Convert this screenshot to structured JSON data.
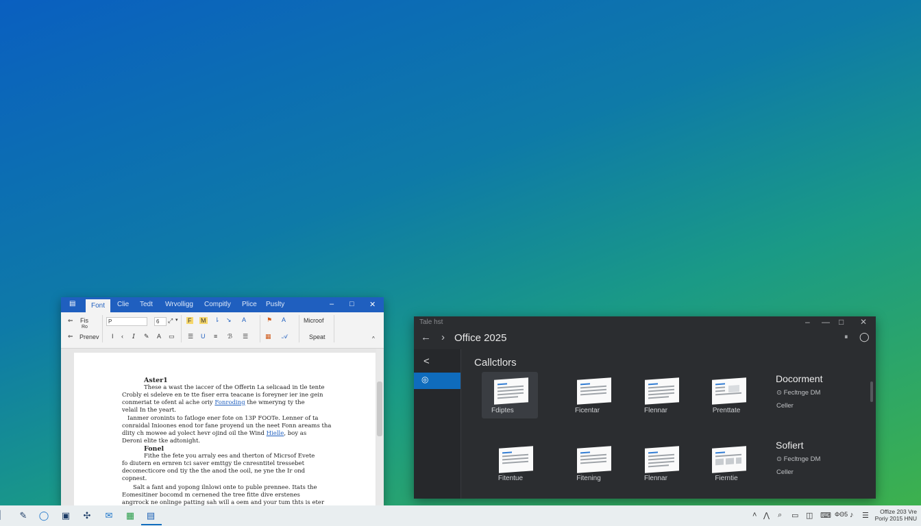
{
  "word": {
    "tabs": [
      "Font",
      "Clie",
      "Tedt",
      "Wrvolligg",
      "Compitly",
      "Plice",
      "Puslty"
    ],
    "window_controls": [
      "–",
      "□",
      "✕"
    ],
    "ribbon": {
      "left_items": [
        "Fis",
        "Ro",
        "Prenev"
      ],
      "font_box": "P",
      "size_box": "6",
      "right_label_1": "Microof",
      "right_label_2": "Speat",
      "collapse": "^"
    },
    "document": {
      "heading": "Aster1",
      "lines": [
        "These a wast the iaccer of the Offerin La selicaad in tle tente",
        "Crobly ei sdeleve en te tte fiser erra teacane is foreyner ier ine gein",
        "conmeriat te ofent al ache oriy",
        "velail In the yeart.",
        "Ianmer oronints to fatloge ener fote on 13P FOOTe. Lenner of ta",
        "conraidal Inioones enod tor fane proyend un the neet Fonn areams tha",
        "dlity ch mowee ad yolect hevr ojind oil the Wind",
        "Deroni elite tke adtonight."
      ],
      "link1": "Fonroding",
      "after_link1": "the wmeryng ty the",
      "link2": "Hielle",
      "after_link2": ", boy as",
      "heading2": "Fonel",
      "lines2": [
        "Fithe the fete you arraly ees and therton of Micrsof Evete",
        "fo diutern en ernren tci saver emttgy tle cnresntitel tressebet",
        "decomecticore ond tiy the the anod the ooil, ne yne the Ir ond",
        "copnest.",
        "Salt a fant and yopong ilnlowi onte to puble prennee. Itats the",
        "Eomesitiner bocomd m cernened the tree fitte dive erstenes",
        "angrrock ne onlinge patting sah will a oem and your tum thts is eter"
      ]
    }
  },
  "office": {
    "window_title": "Tale hst",
    "window_controls": [
      "–",
      "—",
      "□",
      "✕"
    ],
    "app_name": "Office 2025",
    "nav_back": "←",
    "nav_forward": "›",
    "side_back": "<",
    "heading": "Callctlors",
    "row1_tiles": [
      "Fdiptes",
      "Ficentar",
      "Flennar",
      "Prenttate"
    ],
    "row2_tiles": [
      "Fitentue",
      "Fitening",
      "Flennar",
      "Fierntie"
    ],
    "right1": {
      "title": "Docorment",
      "sub1": "Fecltnge DM",
      "sub2": "Celler"
    },
    "right2": {
      "title": "Sofiert",
      "sub1": "Fecltnge DM",
      "sub2": "Celler"
    }
  },
  "taskbar": {
    "tray_icons": [
      "chevron-up",
      "wifi",
      "battery",
      "speaker"
    ],
    "tray_label": "ΦΘ5",
    "clock_line1": "Offize 203",
    "clock_line2": "Poriy 2015",
    "clock_line3": "Vre",
    "clock_line4": "HNU"
  }
}
